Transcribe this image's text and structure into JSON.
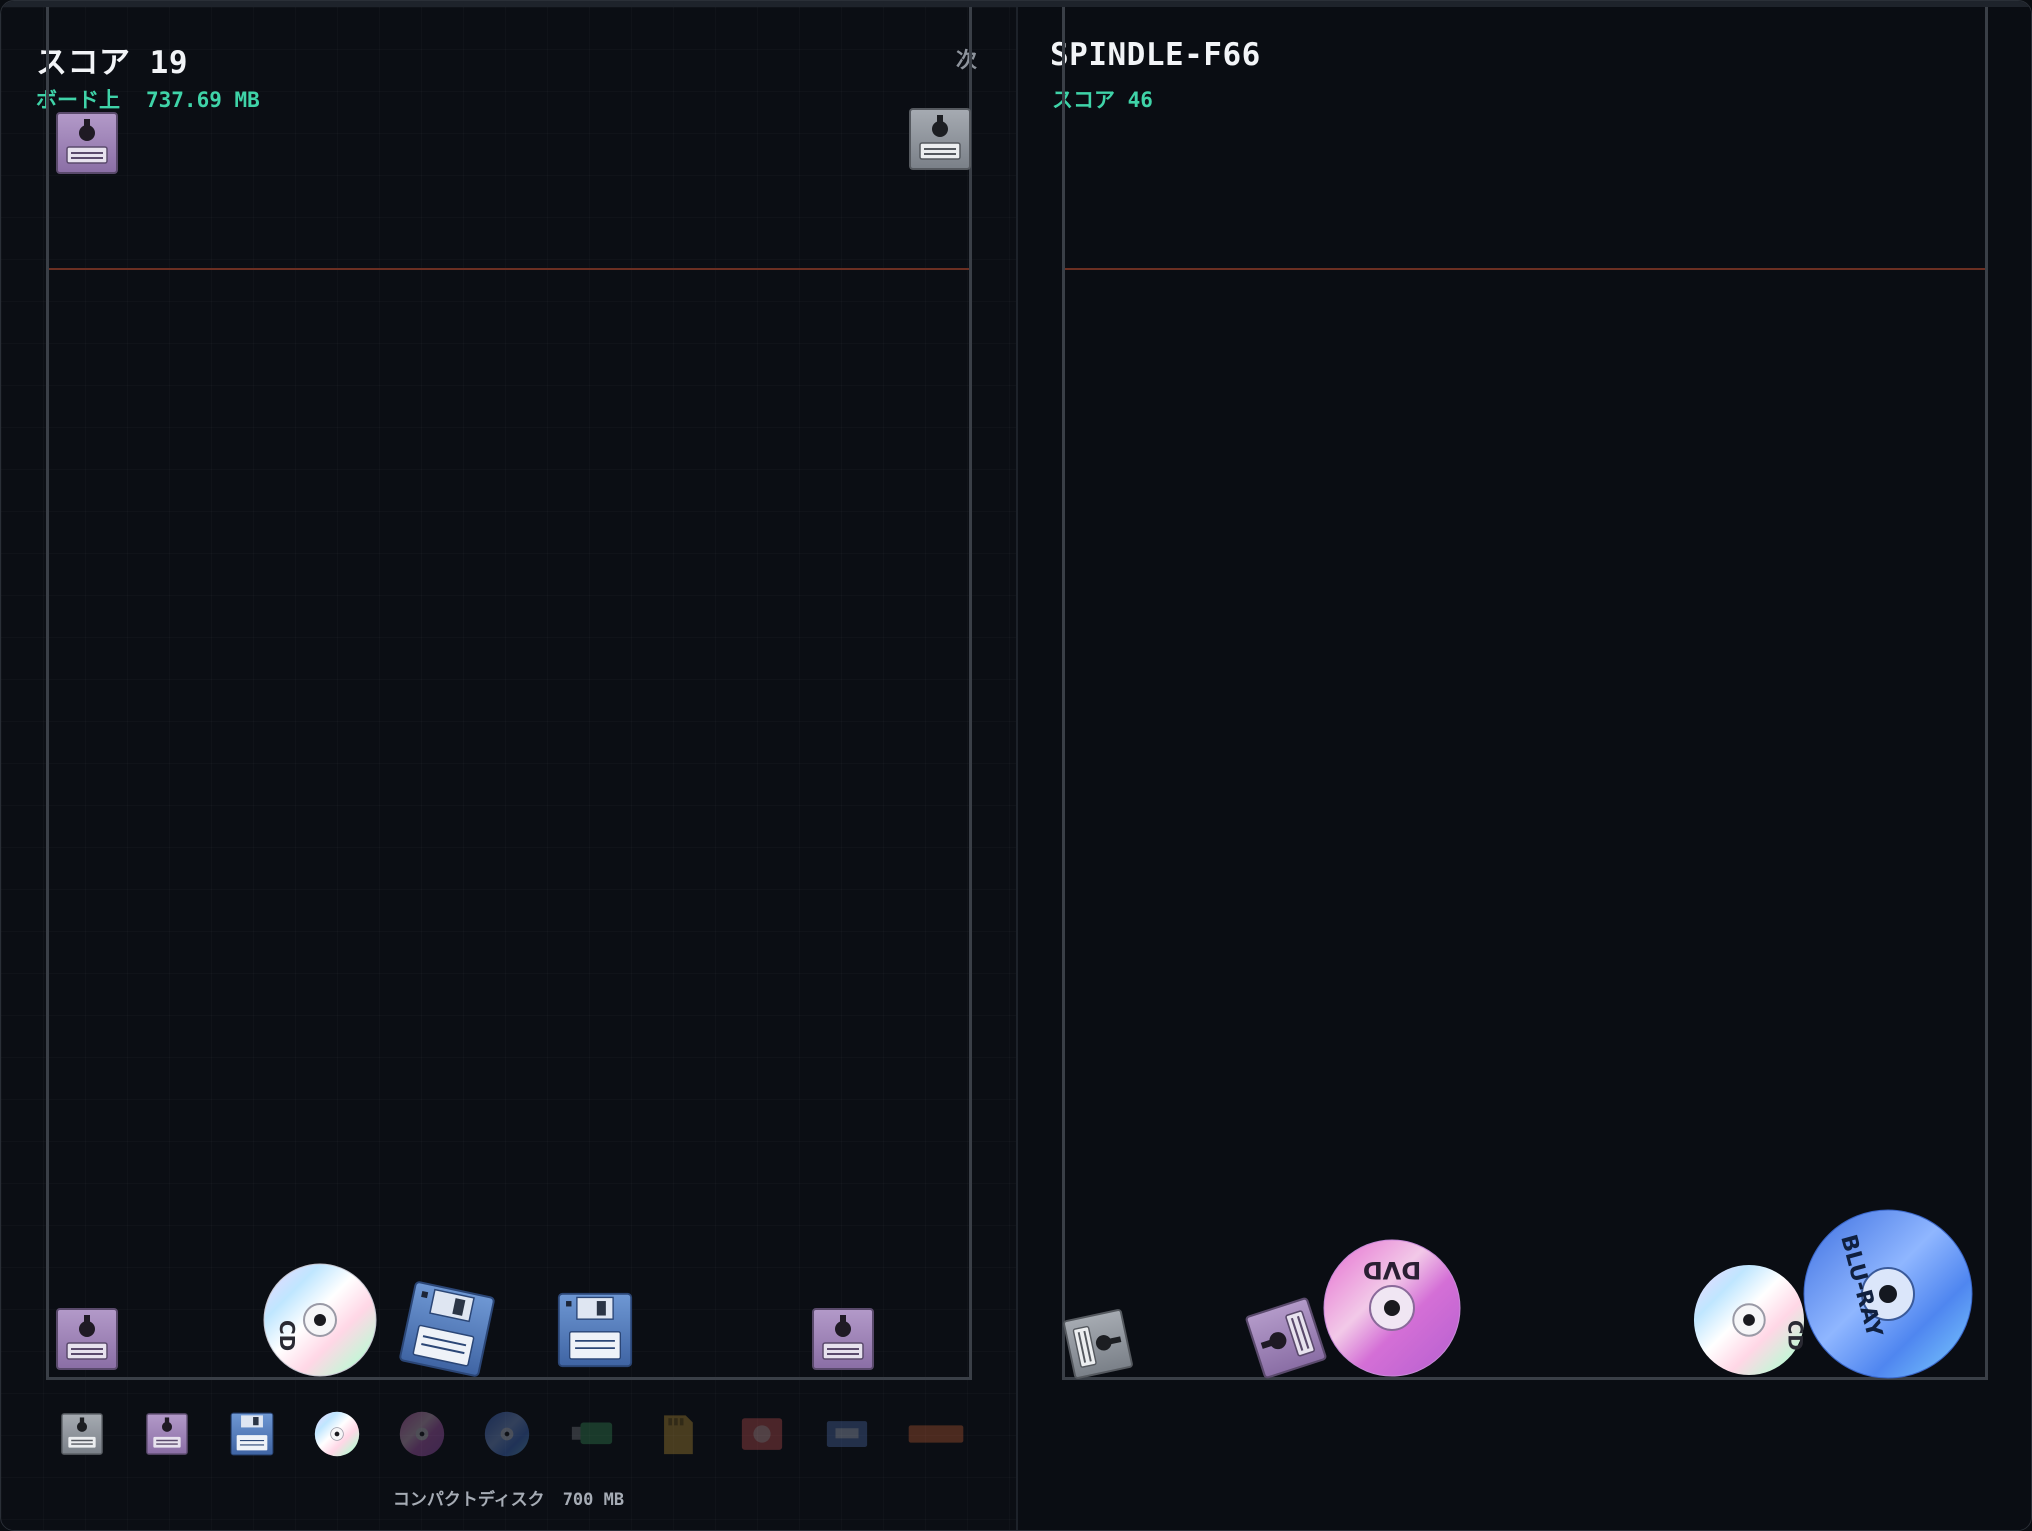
{
  "player": {
    "score_label": "スコア",
    "score_value": "19",
    "onboard_label": "ボード上",
    "onboard_value": "737.69 MB",
    "next_label": "次"
  },
  "opponent": {
    "name": "SPINDLE-F66",
    "score_label": "スコア",
    "score_value": "46"
  },
  "palette": {
    "selected_name": "コンパクトディスク",
    "selected_size": "700 MB",
    "items": [
      "punch-card-icon",
      "floppy-8in-icon",
      "floppy-35-icon",
      "cd-icon",
      "dvd-icon",
      "bluray-icon",
      "usb-drive-icon",
      "sd-card-icon",
      "hard-drive-icon",
      "ssd-icon",
      "tape-icon"
    ]
  },
  "disc_labels": {
    "cd": "CD",
    "dvd": "DVD",
    "bluray": "BLU-RAY"
  },
  "colors": {
    "accent_green": "#3fd3a8",
    "danger_line": "#6b2f22",
    "floppy_blue": "#4f78b8",
    "floppy_purple": "#9b7fb6",
    "card_grey": "#8d9299"
  }
}
